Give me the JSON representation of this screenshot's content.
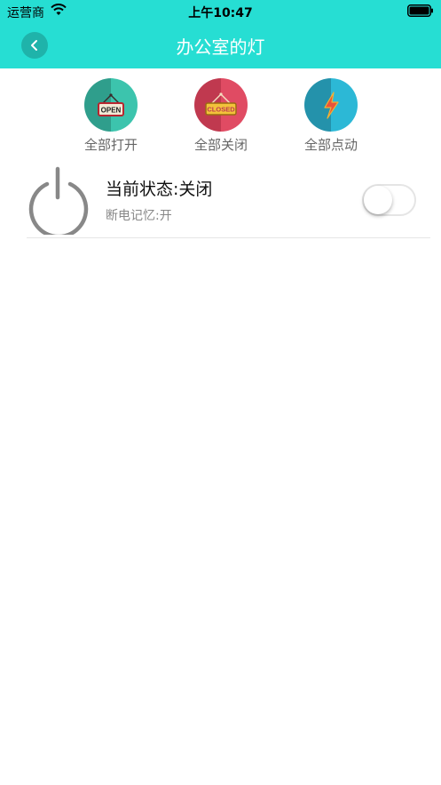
{
  "status_bar": {
    "carrier": "运营商",
    "time": "上午10:47",
    "wifi_icon": "wifi-icon",
    "battery_icon": "battery-icon"
  },
  "nav": {
    "title": "办公室的灯",
    "back_icon": "chevron-left-icon"
  },
  "actions": [
    {
      "label": "全部打开",
      "sign": "OPEN",
      "icon": "open-sign-icon",
      "color_left": "#2f9e8c",
      "color_right": "#3cc4ad"
    },
    {
      "label": "全部关闭",
      "sign": "CLOSED",
      "icon": "closed-sign-icon",
      "color_left": "#c0394f",
      "color_right": "#e04b63"
    },
    {
      "label": "全部点动",
      "icon": "lightning-icon",
      "color_left": "#2492ab",
      "color_right": "#2cb8d6"
    }
  ],
  "device": {
    "state": "当前状态:关闭",
    "memory": "断电记忆:开",
    "toggle_on": false,
    "power_icon": "power-icon"
  },
  "colors": {
    "accent": "#26ded3",
    "back_button": "#1fb3aa",
    "power_icon": "#888888"
  }
}
